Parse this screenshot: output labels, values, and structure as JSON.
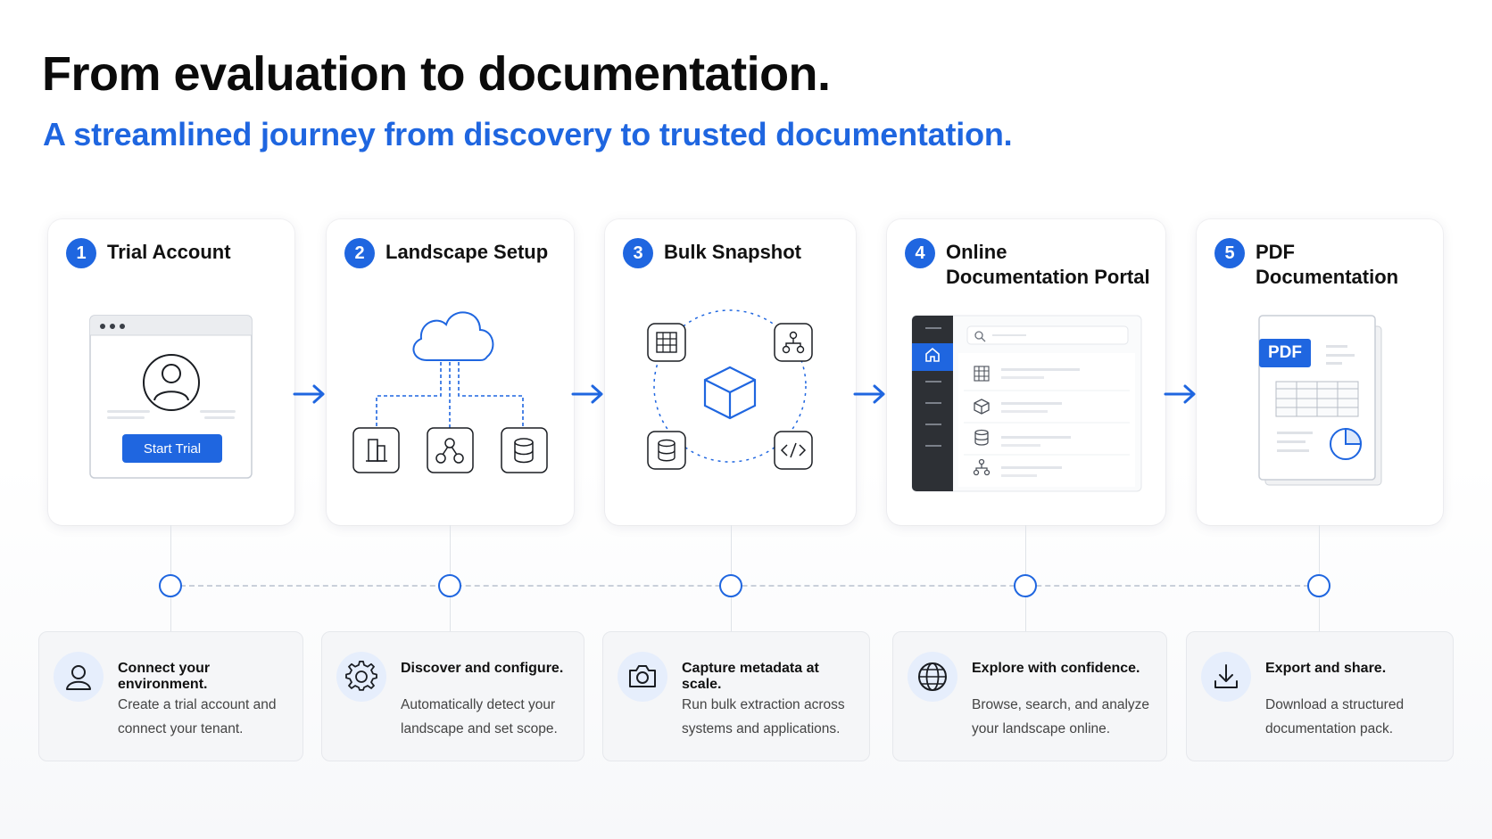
{
  "header": {
    "title": "From evaluation to documentation.",
    "subtitle": "A streamlined journey from discovery to trusted documentation."
  },
  "colors": {
    "accent": "#1f66e0",
    "text": "#111111",
    "muted": "#444444",
    "card_bg": "#ffffff",
    "panel_bg": "#f5f6f8"
  },
  "steps": [
    {
      "number": "1",
      "title": "Trial Account",
      "illustration": "browser-window-with-user",
      "button_label": "Start Trial",
      "detail_icon": "user-icon",
      "heading": "Connect your environment.",
      "line1": "Create a trial account and",
      "line2": "connect your tenant."
    },
    {
      "number": "2",
      "title": "Landscape Setup",
      "illustration": "cloud-to-systems",
      "detail_icon": "gear-icon",
      "heading": "Discover and configure.",
      "line1": "Automatically detect your",
      "line2": "landscape and set scope."
    },
    {
      "number": "3",
      "title": "Bulk Snapshot",
      "illustration": "cube-with-orbit-icons",
      "detail_icon": "camera-icon",
      "heading": "Capture metadata at scale.",
      "line1": "Run bulk extraction across",
      "line2": "systems and applications."
    },
    {
      "number": "4",
      "title": "Online Documentation Portal",
      "illustration": "portal-app-window",
      "detail_icon": "globe-icon",
      "heading": "Explore with confidence.",
      "line1": "Browse, search, and analyze",
      "line2": "your landscape online."
    },
    {
      "number": "5",
      "title": "PDF Documentation",
      "illustration": "pdf-document",
      "pdf_badge": "PDF",
      "detail_icon": "download-icon",
      "heading": "Export and share.",
      "line1": "Download a structured",
      "line2": "documentation pack."
    }
  ]
}
